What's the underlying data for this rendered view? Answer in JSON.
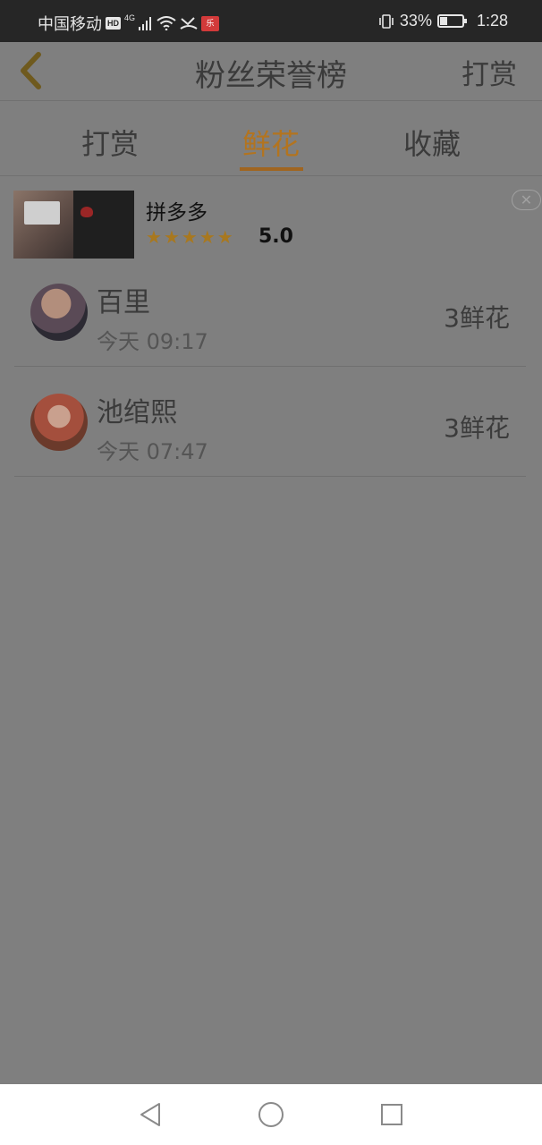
{
  "status_bar": {
    "carrier": "中国移动",
    "hd": "HD",
    "network": "4G",
    "app_badge": "乐",
    "battery": "33%",
    "battery_level": 0.33,
    "time": "1:28"
  },
  "header": {
    "title": "粉丝荣誉榜",
    "right_action": "打赏"
  },
  "tabs": [
    {
      "label": "打赏",
      "active": false
    },
    {
      "label": "鲜花",
      "active": true
    },
    {
      "label": "收藏",
      "active": false
    }
  ],
  "ad": {
    "name": "拼多多",
    "stars": 5,
    "rating": "5.0"
  },
  "list": [
    {
      "name": "百里",
      "time": "今天 09:17",
      "count": "3鲜花"
    },
    {
      "name": "池绾熙",
      "time": "今天 07:47",
      "count": "3鲜花"
    }
  ],
  "colors": {
    "accent": "#b3741f",
    "overlay": "#7f7f7f"
  }
}
